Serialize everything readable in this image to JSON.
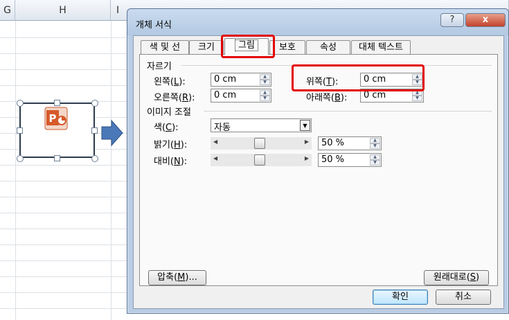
{
  "sheet": {
    "columns": [
      "G",
      "H",
      "I"
    ]
  },
  "dialog": {
    "title": "개체 서식",
    "help_label": "?",
    "close_label": "x",
    "tabs": [
      "색 및 선",
      "크기",
      "그림",
      "보호",
      "속성",
      "대체 텍스트"
    ],
    "active_tab": "그림",
    "crop": {
      "group_label": "자르기",
      "left_label": "왼쪽(",
      "left_key": "L",
      "right_label": "오른쪽(",
      "right_key": "R",
      "top_label": "위쪽(",
      "top_key": "T",
      "bottom_label": "아래쪽(",
      "bottom_key": "B",
      "label_close": "):",
      "left_value": "0 cm",
      "right_value": "0 cm",
      "top_value": "0 cm",
      "bottom_value": "0 cm"
    },
    "image_control": {
      "group_label": "이미지 조절",
      "color_label": "색(",
      "color_key": "C",
      "color_value": "자동",
      "brightness_label": "밝기(",
      "brightness_key": "H",
      "brightness_value": "50 %",
      "contrast_label": "대비(",
      "contrast_key": "N",
      "contrast_value": "50 %",
      "label_close": "):"
    },
    "compress_label_pre": "압축(",
    "compress_key": "M",
    "compress_label_post": ")...",
    "reset_label_pre": "원래대로(",
    "reset_key": "S",
    "reset_label_post": ")",
    "ok_label": "확인",
    "cancel_label": "취소"
  },
  "colors": {
    "highlight": "#e30000",
    "shape_arrow": "#4a78b8",
    "ppt_orange": "#d65a2a"
  }
}
